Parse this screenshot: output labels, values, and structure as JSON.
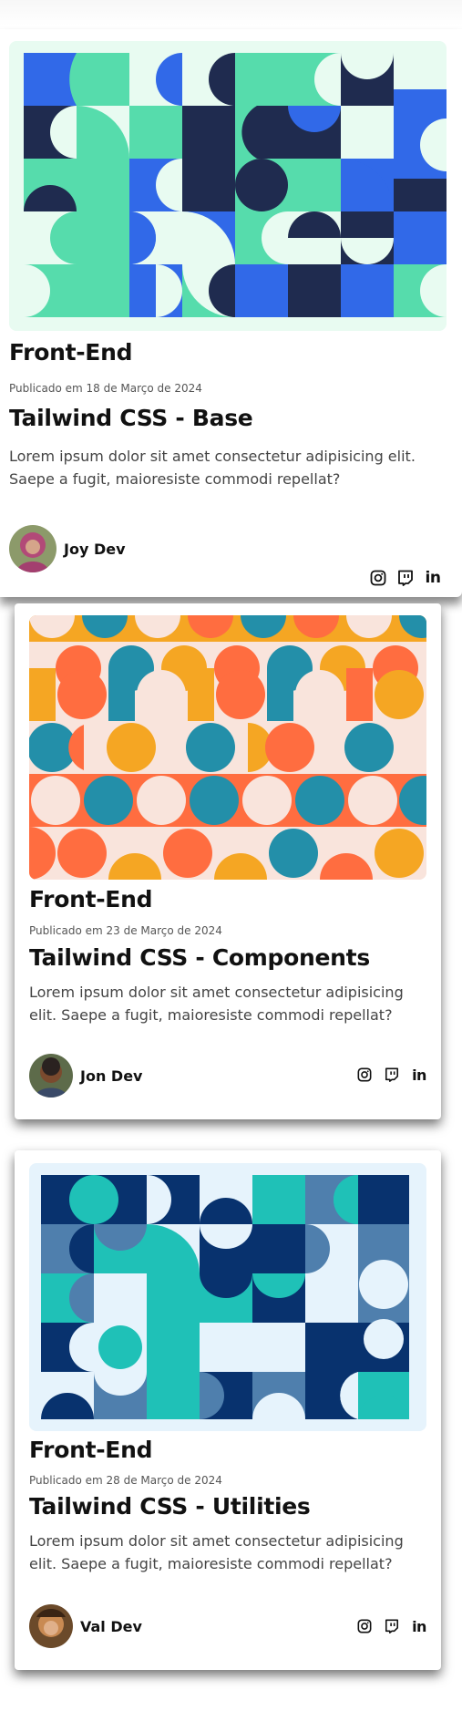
{
  "cards": [
    {
      "category": "Front-End",
      "date": "Publicado em 18 de Março de 2024",
      "title": "Tailwind CSS - Base",
      "description": "Lorem ipsum dolor sit amet consectetur adipisicing elit. Saepe a fugit, maioresiste commodi repellat?",
      "author": "Joy Dev",
      "art_palette": [
        "#e8fbf1",
        "#56dcac",
        "#3169e8",
        "#1f2b4f"
      ],
      "socials": [
        "instagram-icon",
        "twitch-icon",
        "linkedin-icon"
      ]
    },
    {
      "category": "Front-End",
      "date": "Publicado em 23 de Março de 2024",
      "title": "Tailwind CSS - Components",
      "description": "Lorem ipsum dolor sit amet consectetur adipisicing elit. Saepe a fugit, maioresiste commodi repellat?",
      "author": "Jon Dev",
      "art_palette": [
        "#f9e4dc",
        "#ff6d40",
        "#f5a623",
        "#238fa9"
      ],
      "socials": [
        "instagram-icon",
        "twitch-icon",
        "linkedin-icon"
      ]
    },
    {
      "category": "Front-End",
      "date": "Publicado em 28 de Março de 2024",
      "title": "Tailwind CSS - Utilities",
      "description": "Lorem ipsum dolor sit amet consectetur adipisicing elit. Saepe a fugit, maioresiste commodi repellat?",
      "author": "Val Dev",
      "art_palette": [
        "#e6f3fc",
        "#1fc1b7",
        "#4f7fad",
        "#08326e"
      ],
      "socials": [
        "instagram-icon",
        "twitch-icon",
        "linkedin-icon"
      ]
    }
  ]
}
